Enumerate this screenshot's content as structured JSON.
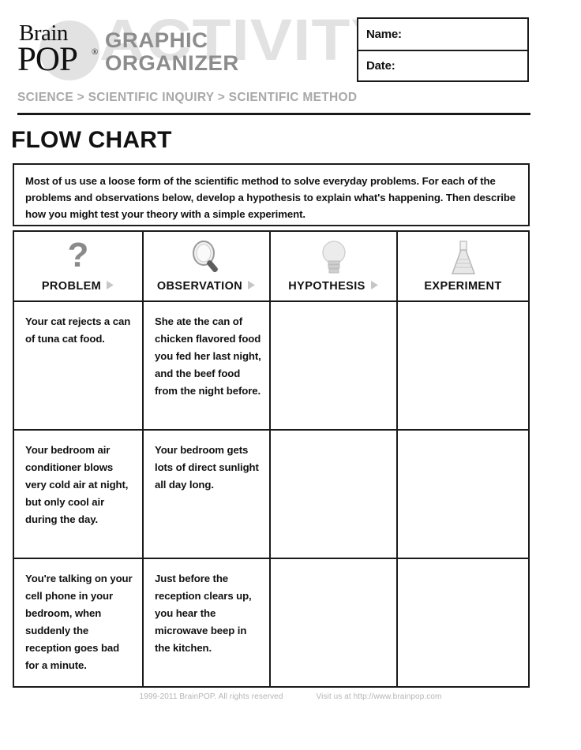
{
  "header": {
    "logo": {
      "brain_text": "Brain",
      "pop_text": "POP",
      "registered_mark": "®"
    },
    "watermark_text": "ACTIVITY",
    "kicker_line1": "GRAPHIC",
    "kicker_line2": "ORGANIZER",
    "breadcrumb": "SCIENCE > SCIENTIFIC INQUIRY > SCIENTIFIC METHOD",
    "name_label": "Name:",
    "date_label": "Date:",
    "name_value": "",
    "date_value": ""
  },
  "title": "FLOW CHART",
  "instructions": "Most of us use a loose form of the scientific method to solve everyday problems. For each of the problems and observations below, develop a hypothesis to explain what's happening. Then describe how you might test your theory with a simple experiment.",
  "table": {
    "columns": [
      {
        "label": "PROBLEM",
        "icon": "question-mark-icon",
        "glyph": "?",
        "arrow": "▶",
        "has_arrow": true
      },
      {
        "label": "OBSERVATION",
        "icon": "magnifying-glass-icon",
        "glyph": "",
        "arrow": "▶",
        "has_arrow": true
      },
      {
        "label": "HYPOTHESIS",
        "icon": "lightbulb-icon",
        "glyph": "",
        "arrow": "▶",
        "has_arrow": true
      },
      {
        "label": "EXPERIMENT",
        "icon": "flask-icon",
        "glyph": "",
        "arrow": "",
        "has_arrow": false
      }
    ],
    "rows": [
      {
        "problem": "Your cat rejects a can of tuna cat food.",
        "observation": "She ate the can of chicken flavored food you fed her last night, and the beef food from the night before.",
        "hypothesis": "",
        "experiment": "",
        "writing_lines": 5
      },
      {
        "problem": "Your bedroom air conditioner blows very cold air at night, but only cool air during the day.",
        "observation": "Your bedroom gets lots of direct sunlight all day long.",
        "hypothesis": "",
        "experiment": "",
        "writing_lines": 5
      },
      {
        "problem": "You're talking on your cell phone in your bedroom, when suddenly the reception goes bad for a minute.",
        "observation": "Just before the reception clears up, you hear the microwave beep in the kitchen.",
        "hypothesis": "",
        "experiment": "",
        "writing_lines": 5
      }
    ]
  },
  "footer": {
    "copyright": "1999-2011 BrainPOP. All rights reserved",
    "visit": "Visit us at http://www.brainpop.com"
  },
  "colors": {
    "ink": "#1a1a1a",
    "watermark_gray": "#e2e2e2",
    "kicker_gray": "#8c8c8c",
    "breadcrumb_gray": "#a8a8a8",
    "footer_gray": "#b5b5b5"
  }
}
